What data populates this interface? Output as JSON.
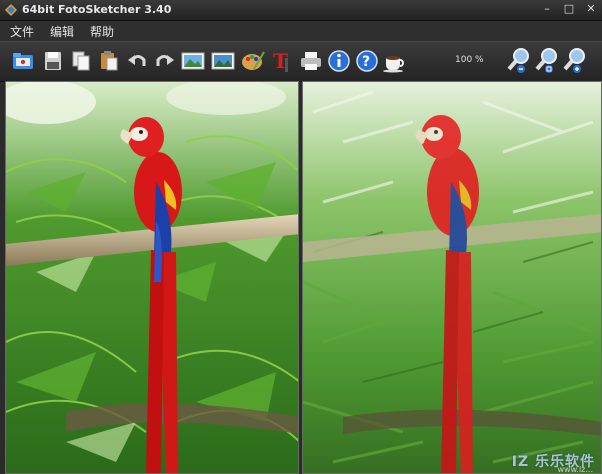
{
  "window": {
    "title": "64bit FotoSketcher 3.40",
    "controls": [
      "–",
      "□",
      "✕"
    ]
  },
  "menu": [
    {
      "label": "文件"
    },
    {
      "label": "编辑"
    },
    {
      "label": "帮助"
    }
  ],
  "toolbar": {
    "buttons": [
      {
        "name": "open-folder-icon",
        "title": "Open"
      },
      {
        "name": "save-icon",
        "title": "Save"
      },
      {
        "name": "copy-icon",
        "title": "Copy"
      },
      {
        "name": "paste-icon",
        "title": "Paste"
      },
      {
        "name": "undo-icon",
        "title": "Undo"
      },
      {
        "name": "redo-icon",
        "title": "Redo"
      },
      {
        "name": "source-image-icon",
        "title": "Source image"
      },
      {
        "name": "result-image-icon",
        "title": "Result image"
      },
      {
        "name": "palette-icon",
        "title": "Drawing parameters"
      },
      {
        "name": "text-icon",
        "title": "Add text"
      },
      {
        "name": "print-icon",
        "title": "Print"
      },
      {
        "name": "info-icon",
        "title": "Info"
      },
      {
        "name": "help-icon",
        "title": "Help"
      },
      {
        "name": "coffee-icon",
        "title": "Donate"
      },
      {
        "name": "zoom-out-icon",
        "title": "Zoom out"
      },
      {
        "name": "zoom-fit-icon",
        "title": "Zoom fit"
      },
      {
        "name": "zoom-in-icon",
        "title": "Zoom in"
      }
    ],
    "zoom": "100 %"
  },
  "colors": {
    "background": "#2b2b2b",
    "toolbar": "#2f2f2f",
    "accent_blue": "#2a6fd6"
  },
  "watermark": {
    "text": "IZ 乐乐软件",
    "sub": "www.lz..."
  }
}
